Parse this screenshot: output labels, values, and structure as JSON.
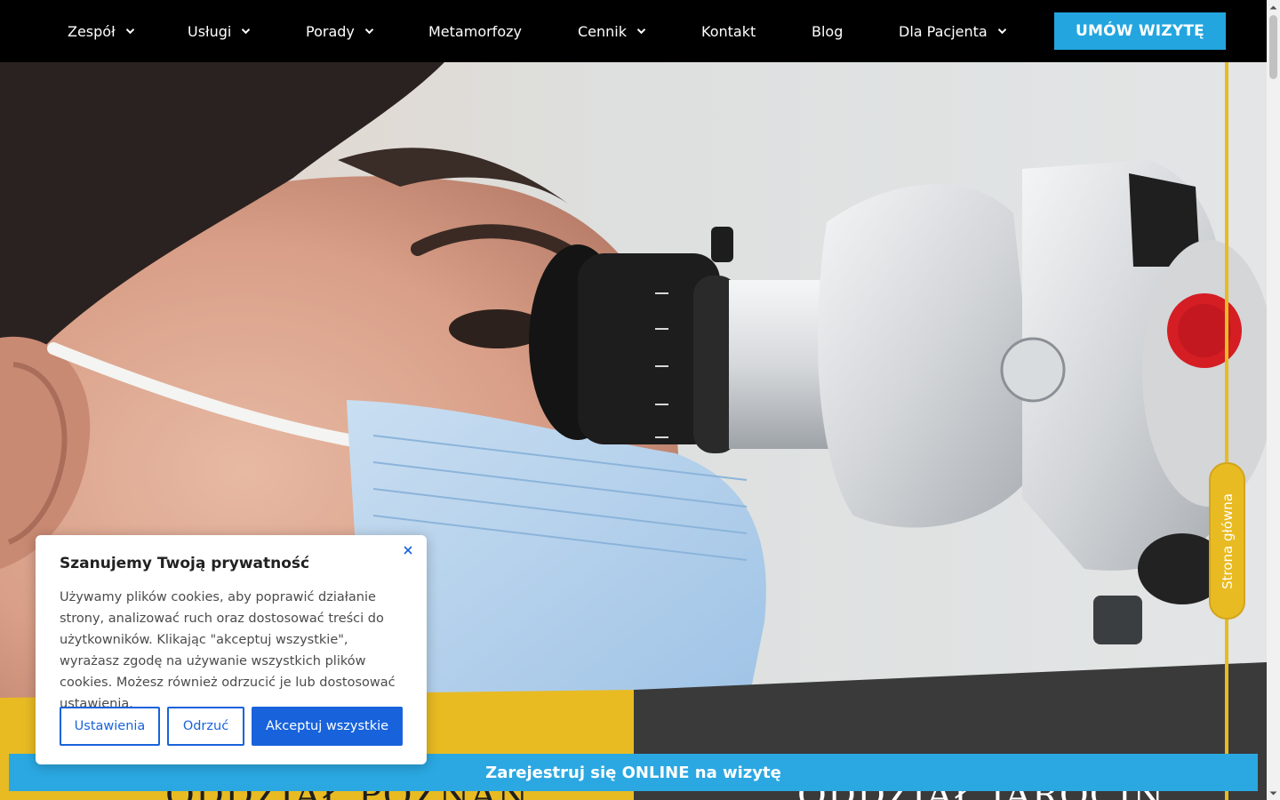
{
  "nav": {
    "items": [
      {
        "label": "Zespół",
        "dropdown": true
      },
      {
        "label": "Usługi",
        "dropdown": true
      },
      {
        "label": "Porady",
        "dropdown": true
      },
      {
        "label": "Metamorfozy",
        "dropdown": false
      },
      {
        "label": "Cennik",
        "dropdown": true
      },
      {
        "label": "Kontakt",
        "dropdown": false
      },
      {
        "label": "Blog",
        "dropdown": false
      },
      {
        "label": "Dla Pacjenta",
        "dropdown": true
      }
    ],
    "cta_label": "UMÓW WIZYTĘ"
  },
  "side_tab": {
    "label": "Strona główna"
  },
  "panels": {
    "left_title": "ODDZIAŁ POZNAŃ",
    "right_title": "ODDZIAŁ JAROCIN"
  },
  "register_bar": {
    "label": "Zarejestruj się ONLINE na wizytę"
  },
  "cookie": {
    "title": "Szanujemy Twoją prywatność",
    "text": "Używamy plików cookies, aby poprawić działanie strony, analizować ruch oraz dostosować treści do użytkowników. Klikając \"akceptuj wszystkie\", wyrażasz zgodę na używanie wszystkich plików cookies. Możesz również odrzucić je lub dostosować ustawienia.",
    "settings_label": "Ustawienia",
    "reject_label": "Odrzuć",
    "accept_label": "Akceptuj wszystkie"
  },
  "colors": {
    "nav_bg": "#000000",
    "cta": "#23a6df",
    "accent_yellow": "#e8bb23",
    "dark_panel": "#3a3a3a",
    "cookie_blue": "#1863dc"
  },
  "icons": [
    "chevron-down-icon",
    "close-icon",
    "scroll-up-icon",
    "scroll-down-icon"
  ]
}
